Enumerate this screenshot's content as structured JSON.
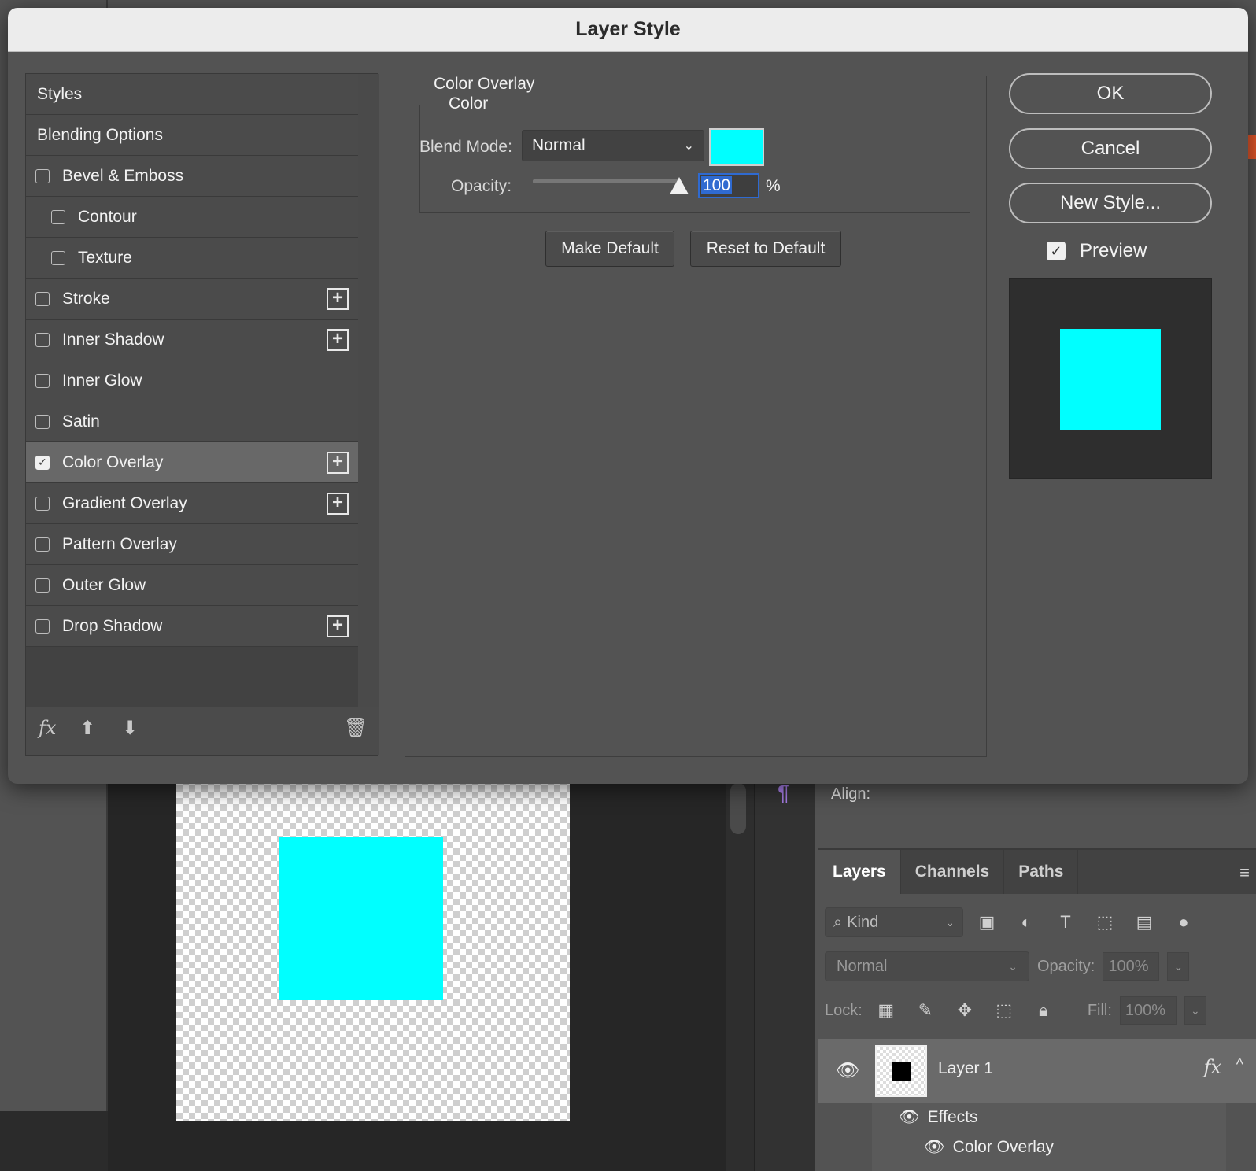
{
  "dialog": {
    "title": "Layer Style",
    "styles": [
      {
        "label": "Styles",
        "type": "header"
      },
      {
        "label": "Blending Options",
        "type": "header"
      },
      {
        "label": "Bevel & Emboss",
        "checked": false,
        "plus": false,
        "sub": false
      },
      {
        "label": "Contour",
        "checked": false,
        "plus": false,
        "sub": true
      },
      {
        "label": "Texture",
        "checked": false,
        "plus": false,
        "sub": true
      },
      {
        "label": "Stroke",
        "checked": false,
        "plus": true,
        "sub": false
      },
      {
        "label": "Inner Shadow",
        "checked": false,
        "plus": true,
        "sub": false
      },
      {
        "label": "Inner Glow",
        "checked": false,
        "plus": false,
        "sub": false
      },
      {
        "label": "Satin",
        "checked": false,
        "plus": false,
        "sub": false
      },
      {
        "label": "Color Overlay",
        "checked": true,
        "plus": true,
        "sub": false,
        "selected": true
      },
      {
        "label": "Gradient Overlay",
        "checked": false,
        "plus": true,
        "sub": false
      },
      {
        "label": "Pattern Overlay",
        "checked": false,
        "plus": false,
        "sub": false
      },
      {
        "label": "Outer Glow",
        "checked": false,
        "plus": false,
        "sub": false
      },
      {
        "label": "Drop Shadow",
        "checked": false,
        "plus": true,
        "sub": false
      }
    ],
    "footer_icons": [
      "fx-icon",
      "move-up-icon",
      "move-down-icon",
      "trash-icon"
    ],
    "settings": {
      "section_title": "Color Overlay",
      "group_title": "Color",
      "blend_mode_label": "Blend Mode:",
      "blend_mode_value": "Normal",
      "overlay_color": "#00ffff",
      "opacity_label": "Opacity:",
      "opacity_value": "100",
      "opacity_unit": "%",
      "opacity_fraction": 1.0,
      "make_default_label": "Make Default",
      "reset_default_label": "Reset to Default"
    },
    "buttons": {
      "ok": "OK",
      "cancel": "Cancel",
      "new_style": "New Style..."
    },
    "preview_label": "Preview",
    "preview_checked": true
  },
  "workspace": {
    "align_label": "Align:",
    "shape_color": "#00ffff"
  },
  "layers_panel": {
    "tabs": [
      "Layers",
      "Channels",
      "Paths"
    ],
    "active_tab": "Layers",
    "kind_placeholder": "Kind",
    "blend_mode": "Normal",
    "opacity_label": "Opacity:",
    "opacity_value": "100%",
    "lock_label": "Lock:",
    "fill_label": "Fill:",
    "fill_value": "100%",
    "layer_name": "Layer 1",
    "effects_label": "Effects",
    "effect_item": "Color Overlay"
  }
}
